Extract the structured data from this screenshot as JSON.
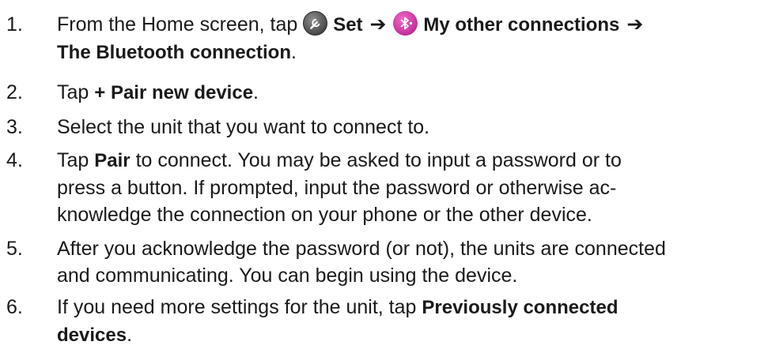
{
  "steps": [
    {
      "number": "1.",
      "line1_prefix": "From the Home screen, tap ",
      "set_label": "Set",
      "other_connections_label": "My other connections",
      "bluetooth_connection_label": "The Bluetooth connection",
      "line2_suffix": ".",
      "arrow": "➔",
      "icons": [
        "wrench-icon",
        "bluetooth-icon"
      ]
    },
    {
      "number": "2.",
      "prefix": "Tap ",
      "bold": "+ Pair new device",
      "suffix": "."
    },
    {
      "number": "3.",
      "text": "Select the unit that you want to connect to."
    },
    {
      "number": "4.",
      "prefix": "Tap ",
      "bold": "Pair",
      "line1_suffix": " to connect. You may be asked to input a password or to",
      "line2": "press a button. If prompted, input the password or otherwise ac-",
      "line3": "knowledge the connection on your phone or the other device."
    },
    {
      "number": "5.",
      "line1": "After you acknowledge the password (or not), the units are connected",
      "line2": "and communicating. You can begin using the device."
    },
    {
      "number": "6.",
      "prefix": "If you need more settings for the unit, tap ",
      "bold_line1": "Previously connected",
      "bold_line2": "devices",
      "suffix": "."
    }
  ],
  "colors": {
    "text": "#1a1a1a",
    "wrench_icon_bg": "#4a4a4a",
    "bluetooth_icon_bg": "#c02a97"
  }
}
